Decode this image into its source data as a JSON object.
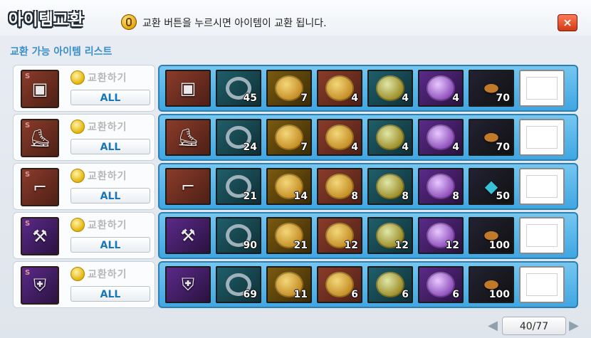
{
  "window": {
    "title": "아이템교환",
    "hint": "교환 버튼을 누르시면 아이템이 교환 됩니다.",
    "close": "×"
  },
  "list": {
    "title": "교환 가능 아이템 리스트"
  },
  "rows": [
    {
      "target": {
        "item_icon": "armor-icon",
        "grade": "S"
      },
      "exchange_label": "교환하기",
      "all_label": "ALL",
      "materials": [
        "45",
        "7",
        "4",
        "4",
        "4",
        "70"
      ]
    },
    {
      "target": {
        "item_icon": "shoes-icon",
        "grade": "S"
      },
      "exchange_label": "교환하기",
      "all_label": "ALL",
      "materials": [
        "24",
        "7",
        "4",
        "4",
        "4",
        "70"
      ]
    },
    {
      "target": {
        "item_icon": "goggles-icon",
        "grade": "S"
      },
      "exchange_label": "교환하기",
      "all_label": "ALL",
      "materials": [
        "21",
        "14",
        "8",
        "8",
        "8",
        "50"
      ]
    },
    {
      "target": {
        "item_icon": "mace-icon",
        "grade": "S"
      },
      "exchange_label": "교환하기",
      "all_label": "ALL",
      "materials": [
        "90",
        "21",
        "12",
        "12",
        "12",
        "100"
      ]
    },
    {
      "target": {
        "item_icon": "armor-dark-icon",
        "grade": "S"
      },
      "exchange_label": "교환하기",
      "all_label": "ALL",
      "materials": [
        "69",
        "11",
        "6",
        "6",
        "6",
        "100"
      ]
    }
  ],
  "pager": {
    "label": "40/77",
    "prev": "◀",
    "next": "▶"
  }
}
